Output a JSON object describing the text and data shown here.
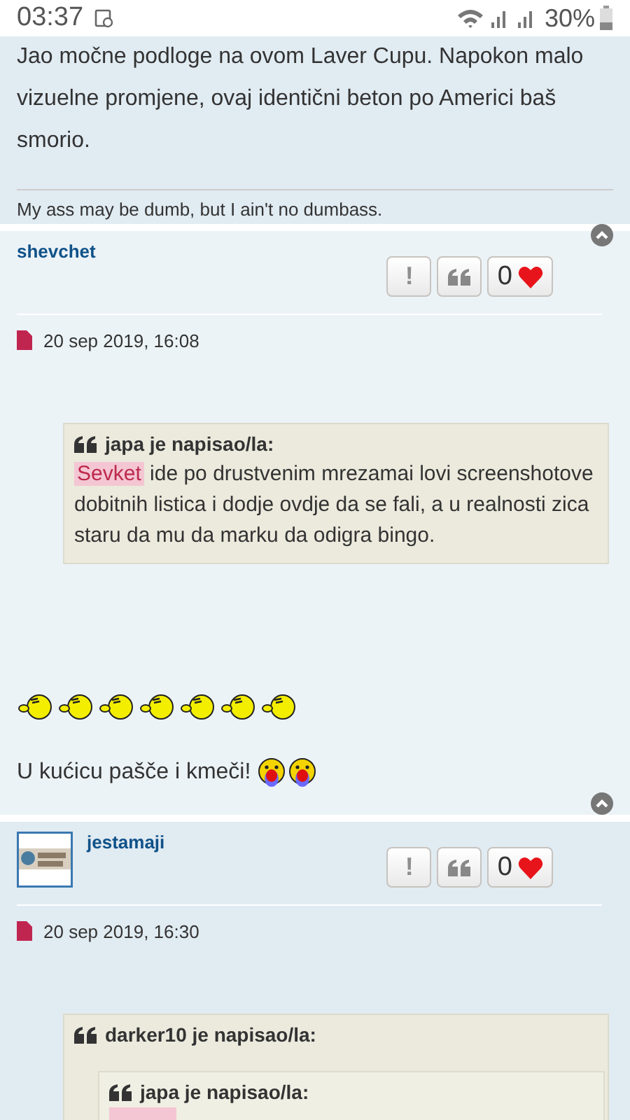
{
  "status_bar": {
    "time": "03:37",
    "battery": "30%"
  },
  "posts": [
    {
      "kind": "tail",
      "body": "Jao močne podloge na ovom Laver Cupu. Napokon malo vizuelne promjene, ovaj identični beton po Americi baš smorio.",
      "signature": "My ass may be dumb, but I ain't no dumbass."
    },
    {
      "kind": "full",
      "author": "shevchet",
      "avatar": false,
      "report": "!",
      "likes": "0",
      "date": "20 sep 2019, 16:08",
      "quote": {
        "header": "japa je napisao/la:",
        "mention": "Sevket",
        "text": " ide po drustvenim mrezamai lovi screenshotove dobitnih listica i dodje ovdje da se fali, a u realnosti zica staru da mu da marku da odigra bingo."
      },
      "smileys": [
        {
          "kind": "blowing"
        },
        {
          "kind": "blowing"
        },
        {
          "kind": "blowing"
        },
        {
          "kind": "blowing"
        },
        {
          "kind": "blowing"
        },
        {
          "kind": "blowing"
        },
        {
          "kind": "blowing"
        }
      ],
      "line": {
        "text": "U kućicu pašče i kmeči!",
        "smileys": [
          {
            "kind": "crying"
          },
          {
            "kind": "crying"
          }
        ]
      }
    },
    {
      "kind": "full",
      "author": "jestamaji",
      "avatar": true,
      "report": "!",
      "likes": "0",
      "date": "20 sep 2019, 16:30",
      "quote": {
        "header": "darker10 je napisao/la:",
        "inner": {
          "header": "japa je napisao/la:"
        }
      }
    }
  ]
}
